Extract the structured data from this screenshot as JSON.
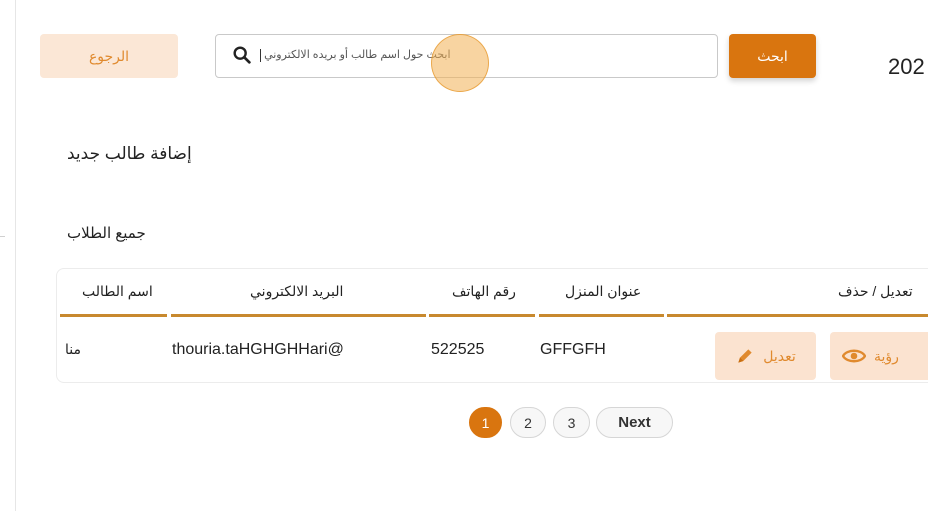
{
  "header": {
    "back_label": "الرجوع",
    "search_value": "ابحث حول اسم طالب أو بريده الالكتروني",
    "search_button_label": "ابحث",
    "year_partial": "202"
  },
  "main": {
    "add_student_label": "إضافة طالب جديد",
    "all_students_label": "جميع الطلاب"
  },
  "table": {
    "columns": [
      "اسم الطالب",
      "البريد الالكتروني",
      "رقم الهاتف",
      "عنوان المنزل",
      "تعديل / حذف"
    ],
    "rows": [
      {
        "name": "منا",
        "email": "thouria.taHGHGHHari@",
        "phone": "522525",
        "address": "GFFGFH",
        "edit_label": "تعديل",
        "view_label": "رؤية"
      }
    ]
  },
  "pagination": {
    "pages": [
      "1",
      "2",
      "3"
    ],
    "active_page": "1",
    "next_label": "Next"
  },
  "colors": {
    "accent": "#d9750f",
    "accent_light": "#fbe3d0",
    "table_rule": "#c8892e"
  },
  "icons": {
    "search": "search-icon",
    "edit": "pencil-icon",
    "view": "eye-icon"
  }
}
